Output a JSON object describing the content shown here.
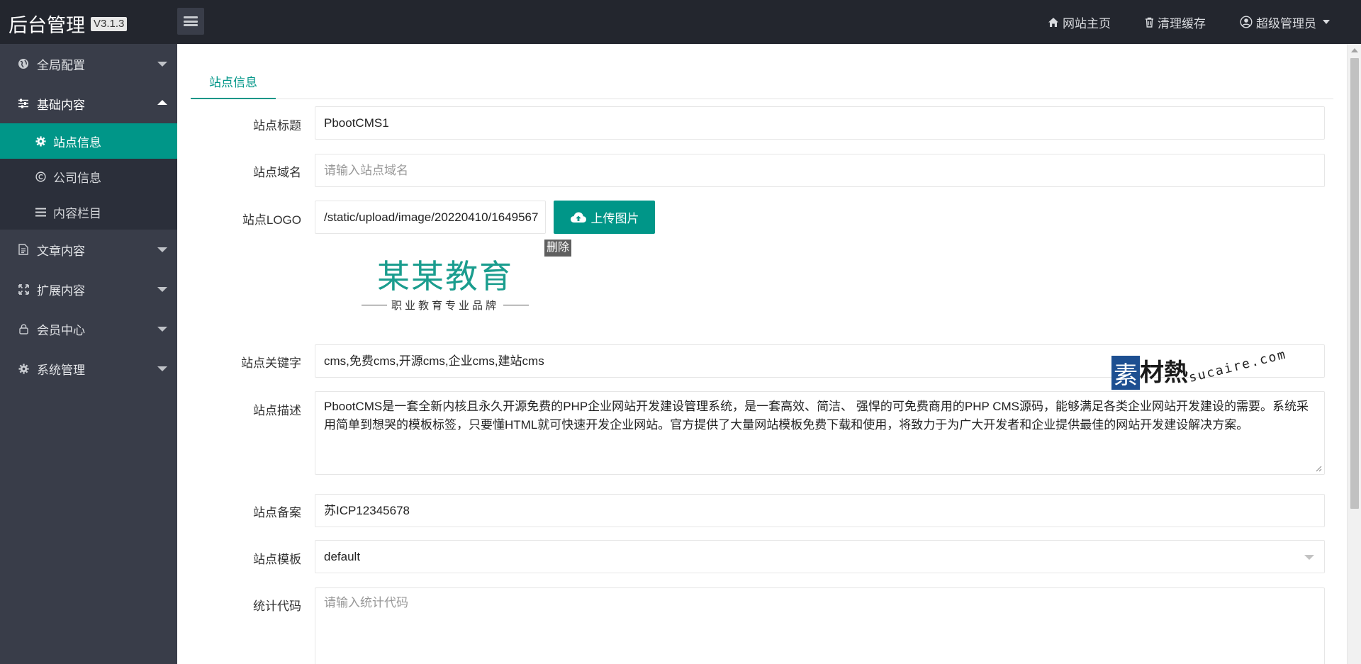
{
  "header": {
    "title": "后台管理",
    "version": "V3.1.3",
    "links": {
      "home": "网站主页",
      "clear_cache": "清理缓存",
      "user": "超级管理员"
    }
  },
  "sidebar": {
    "items": [
      {
        "label": "全局配置",
        "icon": "globe-icon"
      },
      {
        "label": "基础内容",
        "icon": "sliders-icon"
      },
      {
        "label": "文章内容",
        "icon": "document-icon"
      },
      {
        "label": "扩展内容",
        "icon": "expand-icon"
      },
      {
        "label": "会员中心",
        "icon": "lock-icon"
      },
      {
        "label": "系统管理",
        "icon": "gear-icon"
      }
    ],
    "sub_items": [
      {
        "label": "站点信息",
        "icon": "gear-icon"
      },
      {
        "label": "公司信息",
        "icon": "copyright-icon"
      },
      {
        "label": "内容栏目",
        "icon": "list-icon"
      }
    ]
  },
  "main": {
    "tab": "站点信息",
    "form": {
      "title": {
        "label": "站点标题",
        "value": "PbootCMS1"
      },
      "domain": {
        "label": "站点域名",
        "placeholder": "请输入站点域名"
      },
      "logo": {
        "label": "站点LOGO",
        "value": "/static/upload/image/20220410/1649567",
        "upload_label": "上传图片",
        "delete_label": "删除"
      },
      "logo_preview": {
        "main": "某某教育",
        "sub": "职业教育专业品牌"
      },
      "keywords": {
        "label": "站点关键字",
        "value": "cms,免费cms,开源cms,企业cms,建站cms"
      },
      "description": {
        "label": "站点描述",
        "value": "PbootCMS是一套全新内核且永久开源免费的PHP企业网站开发建设管理系统，是一套高效、简洁、 强悍的可免费商用的PHP CMS源码，能够满足各类企业网站开发建设的需要。系统采用简单到想哭的模板标签，只要懂HTML就可快速开发企业网站。官方提供了大量网站模板免费下载和使用，将致力于为广大开发者和企业提供最佳的网站开发建设解决方案。"
      },
      "icp": {
        "label": "站点备案",
        "value": "苏ICP12345678"
      },
      "template": {
        "label": "站点模板",
        "value": "default"
      },
      "stats": {
        "label": "统计代码",
        "placeholder": "请输入统计代码"
      }
    },
    "watermark": {
      "box": "素",
      "text": "材熱",
      "domain": "sucaire.com"
    }
  },
  "colors": {
    "accent": "#009688",
    "header_bg": "#23262e",
    "sidebar_bg": "#393d49"
  }
}
